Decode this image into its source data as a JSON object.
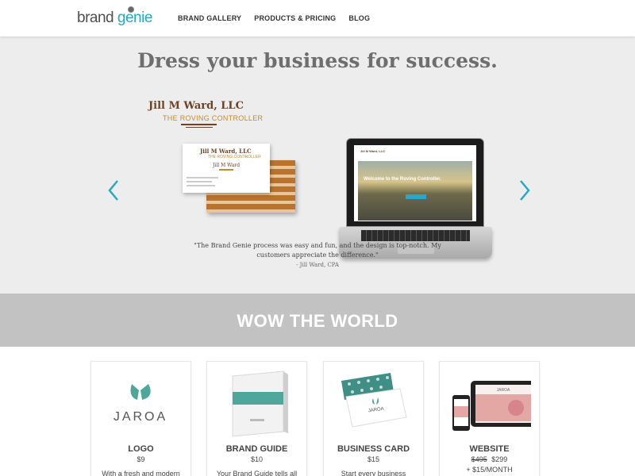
{
  "header": {
    "logo_part1": "brand",
    "logo_part2": "genie",
    "nav": [
      "BRAND GALLERY",
      "PRODUCTS & PRICING",
      "BLOG"
    ]
  },
  "hero": {
    "title": "Dress your business for success.",
    "card_name": "Jill M Ward, LLC",
    "card_tagline": "THE ROVING CONTROLLER",
    "card_small_name": "Jill M Ward, LLC",
    "card_small_tagline": "THE ROVING CONTROLLER",
    "card_person": "Jill M Ward",
    "site_name": "Jill M Ward, LLC",
    "site_headline": "Welcome to the Roving Controller.",
    "quote_line1": "\"The Brand Genie process was easy and fun, and the design is top-notch. My",
    "quote_line2": "customers appreciate the difference.\"",
    "quote_author": "- Jill Ward, CPA"
  },
  "banner": {
    "title": "WOW THE WORLD"
  },
  "products": [
    {
      "name": "LOGO",
      "price": "$9",
      "desc": "With a fresh and modern",
      "brand": "JAROA"
    },
    {
      "name": "BRAND GUIDE",
      "price": "$10",
      "desc": "Your Brand Guide tells all"
    },
    {
      "name": "BUSINESS CARD",
      "price": "$15",
      "desc": "Start every business",
      "brand": "JAROA"
    },
    {
      "name": "WEBSITE",
      "old_price": "$495",
      "price": "$299",
      "extra": "+ $15/MONTH",
      "brand": "JAROA"
    }
  ],
  "colors": {
    "accent": "#2aa6c8",
    "teal": "#4fa69a",
    "banner": "#c2c2c2",
    "hero_bg": "#ededed"
  }
}
